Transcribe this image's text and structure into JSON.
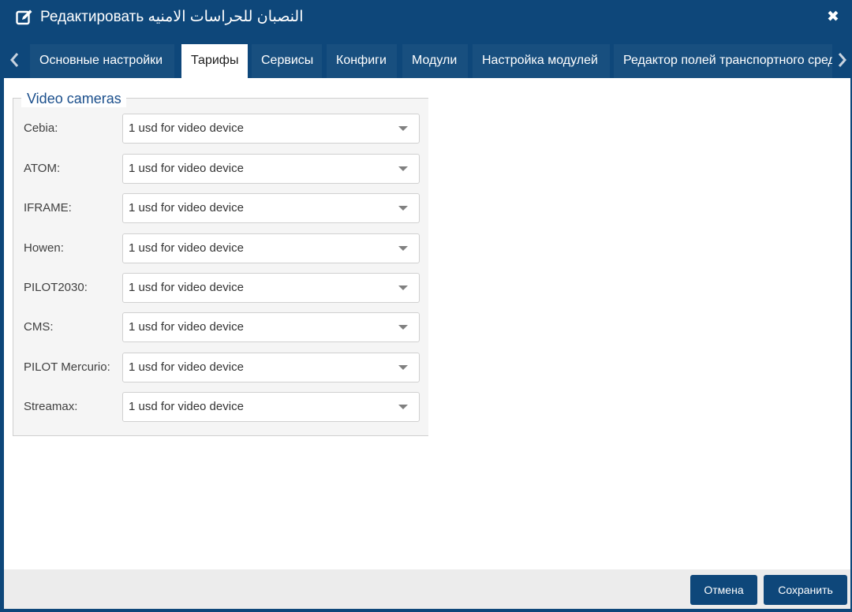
{
  "header": {
    "title": "Редактировать النصبان للحراسات الامنيه",
    "edit_icon": "edit-icon",
    "close_icon": "close-icon"
  },
  "tabs": [
    {
      "label": "Основные настройки",
      "active": false
    },
    {
      "label": "Тарифы",
      "active": true
    },
    {
      "label": "Сервисы",
      "active": false
    },
    {
      "label": "Конфиги",
      "active": false
    },
    {
      "label": "Модули",
      "active": false
    },
    {
      "label": "Настройка модулей",
      "active": false
    },
    {
      "label": "Редактор полей транспортного средства",
      "active": false
    }
  ],
  "section": {
    "legend": "Video cameras",
    "rows": [
      {
        "label": "Cebia:",
        "value": "1 usd for video device"
      },
      {
        "label": "ATOM:",
        "value": "1 usd for video device"
      },
      {
        "label": "IFRAME:",
        "value": "1 usd for video device"
      },
      {
        "label": "Howen:",
        "value": "1 usd for video device"
      },
      {
        "label": "PILOT2030:",
        "value": "1 usd for video device"
      },
      {
        "label": "CMS:",
        "value": "1 usd for video device"
      },
      {
        "label": "PILOT Mercurio:",
        "value": "1 usd for video device"
      },
      {
        "label": "Streamax:",
        "value": "1 usd for video device"
      }
    ]
  },
  "footer": {
    "cancel_label": "Отмена",
    "save_label": "Сохранить"
  },
  "colors": {
    "primary": "#0e477a",
    "tab": "#184f7f",
    "legend": "#1b4f8c",
    "panel": "#f5f5f5",
    "footer": "#ececec"
  }
}
